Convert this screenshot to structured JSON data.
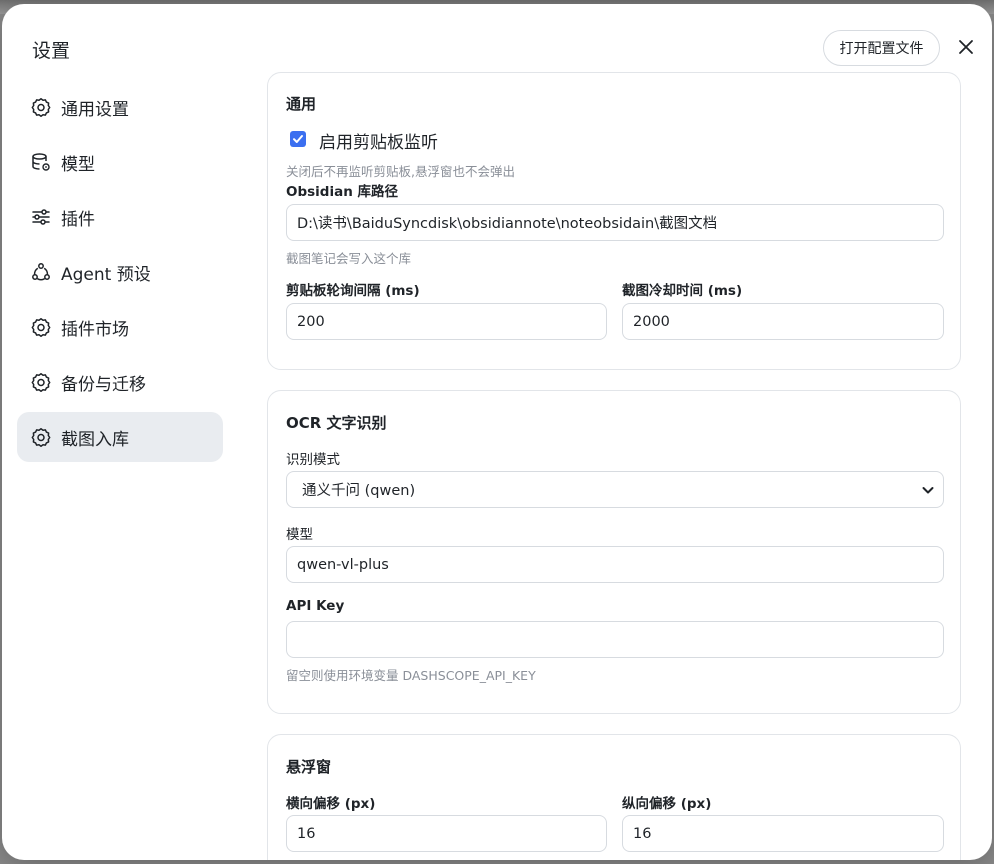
{
  "dialog": {
    "title": "设置",
    "open_config_label": "打开配置文件"
  },
  "sidebar": {
    "items": [
      {
        "label": "通用设置",
        "icon": "gear-icon"
      },
      {
        "label": "模型",
        "icon": "database-gear-icon"
      },
      {
        "label": "插件",
        "icon": "sliders-icon"
      },
      {
        "label": "Agent 预设",
        "icon": "agent-nodes-icon"
      },
      {
        "label": "插件市场",
        "icon": "gear-icon"
      },
      {
        "label": "备份与迁移",
        "icon": "gear-icon"
      },
      {
        "label": "截图入库",
        "icon": "gear-icon",
        "active": true
      }
    ]
  },
  "general": {
    "title": "通用",
    "clipboard_checkbox_label": "启用剪贴板监听",
    "clipboard_checked": true,
    "clipboard_hint": "关闭后不再监听剪贴板,悬浮窗也不会弹出",
    "vault_label": "Obsidian 库路径",
    "vault_value": "D:\\读书\\BaiduSyncdisk\\obsidiannote\\noteobsidain\\截图文档",
    "vault_hint": "截图笔记会写入这个库",
    "poll_label": "剪贴板轮询间隔 (ms)",
    "poll_value": "200",
    "cooldown_label": "截图冷却时间 (ms)",
    "cooldown_value": "2000"
  },
  "ocr": {
    "title": "OCR 文字识别",
    "mode_label": "识别模式",
    "mode_value": "通义千问 (qwen)",
    "model_label": "模型",
    "model_value": "qwen-vl-plus",
    "apikey_label": "API Key",
    "apikey_value": "",
    "apikey_hint": "留空则使用环境变量 DASHSCOPE_API_KEY"
  },
  "floating": {
    "title": "悬浮窗",
    "offset_x_label": "横向偏移 (px)",
    "offset_x_value": "16",
    "offset_y_label": "纵向偏移 (px)",
    "offset_y_value": "16"
  },
  "colors": {
    "accent": "#3b6ff0",
    "active_nav_bg": "#e9ecf0",
    "border": "#d7dbe0",
    "hint_text": "#8a8f98"
  }
}
